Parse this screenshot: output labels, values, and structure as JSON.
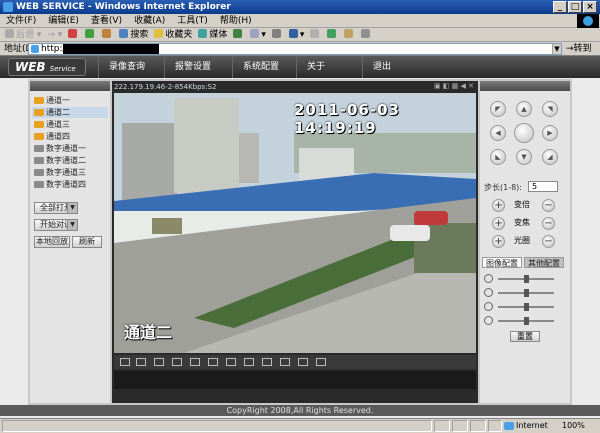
{
  "window": {
    "title": "WEB SERVICE - Windows Internet Explorer"
  },
  "menu": [
    "文件(F)",
    "编辑(E)",
    "查看(V)",
    "收藏(A)",
    "工具(T)",
    "帮助(H)"
  ],
  "toolbar": {
    "back": "后退",
    "search": "搜索",
    "favorites": "收藏夹",
    "media": "媒体"
  },
  "address": {
    "label": "地址(D)",
    "value": "http://",
    "go": "转到"
  },
  "app": {
    "logo": "WEB",
    "logo_sub": "Service",
    "nav": [
      "录像查询",
      "报警设置",
      "系统配置",
      "关于",
      "退出"
    ]
  },
  "channels": [
    "通道一",
    "通道二",
    "通道三",
    "通道四",
    "数字通道一",
    "数字通道二",
    "数字通道三",
    "数字通道四"
  ],
  "left_buttons": {
    "open_all": "全部打开",
    "talk": "开始对讲",
    "local_playback": "本地回放",
    "refresh": "刷新"
  },
  "video": {
    "info": "222.179.19.46-2-854Kbps:S2",
    "osd_time": "2011-06-03 14:19:19",
    "osd_channel": "通道二"
  },
  "ptz": {
    "step_label": "步长(1-8):",
    "step_value": "5",
    "controls": [
      "变倍",
      "变焦",
      "光圈"
    ],
    "tabs": [
      "图像配置",
      "其他配置"
    ],
    "reset": "重置"
  },
  "footer": {
    "copyright": "CopyRight 2008,All Rights Reserved."
  },
  "status": {
    "zone": "Internet",
    "zoom": "100%"
  },
  "colors": {
    "header": "#3a3a3a",
    "title_bar": "#0b3a8c",
    "channel_icon": "#e8a020"
  }
}
